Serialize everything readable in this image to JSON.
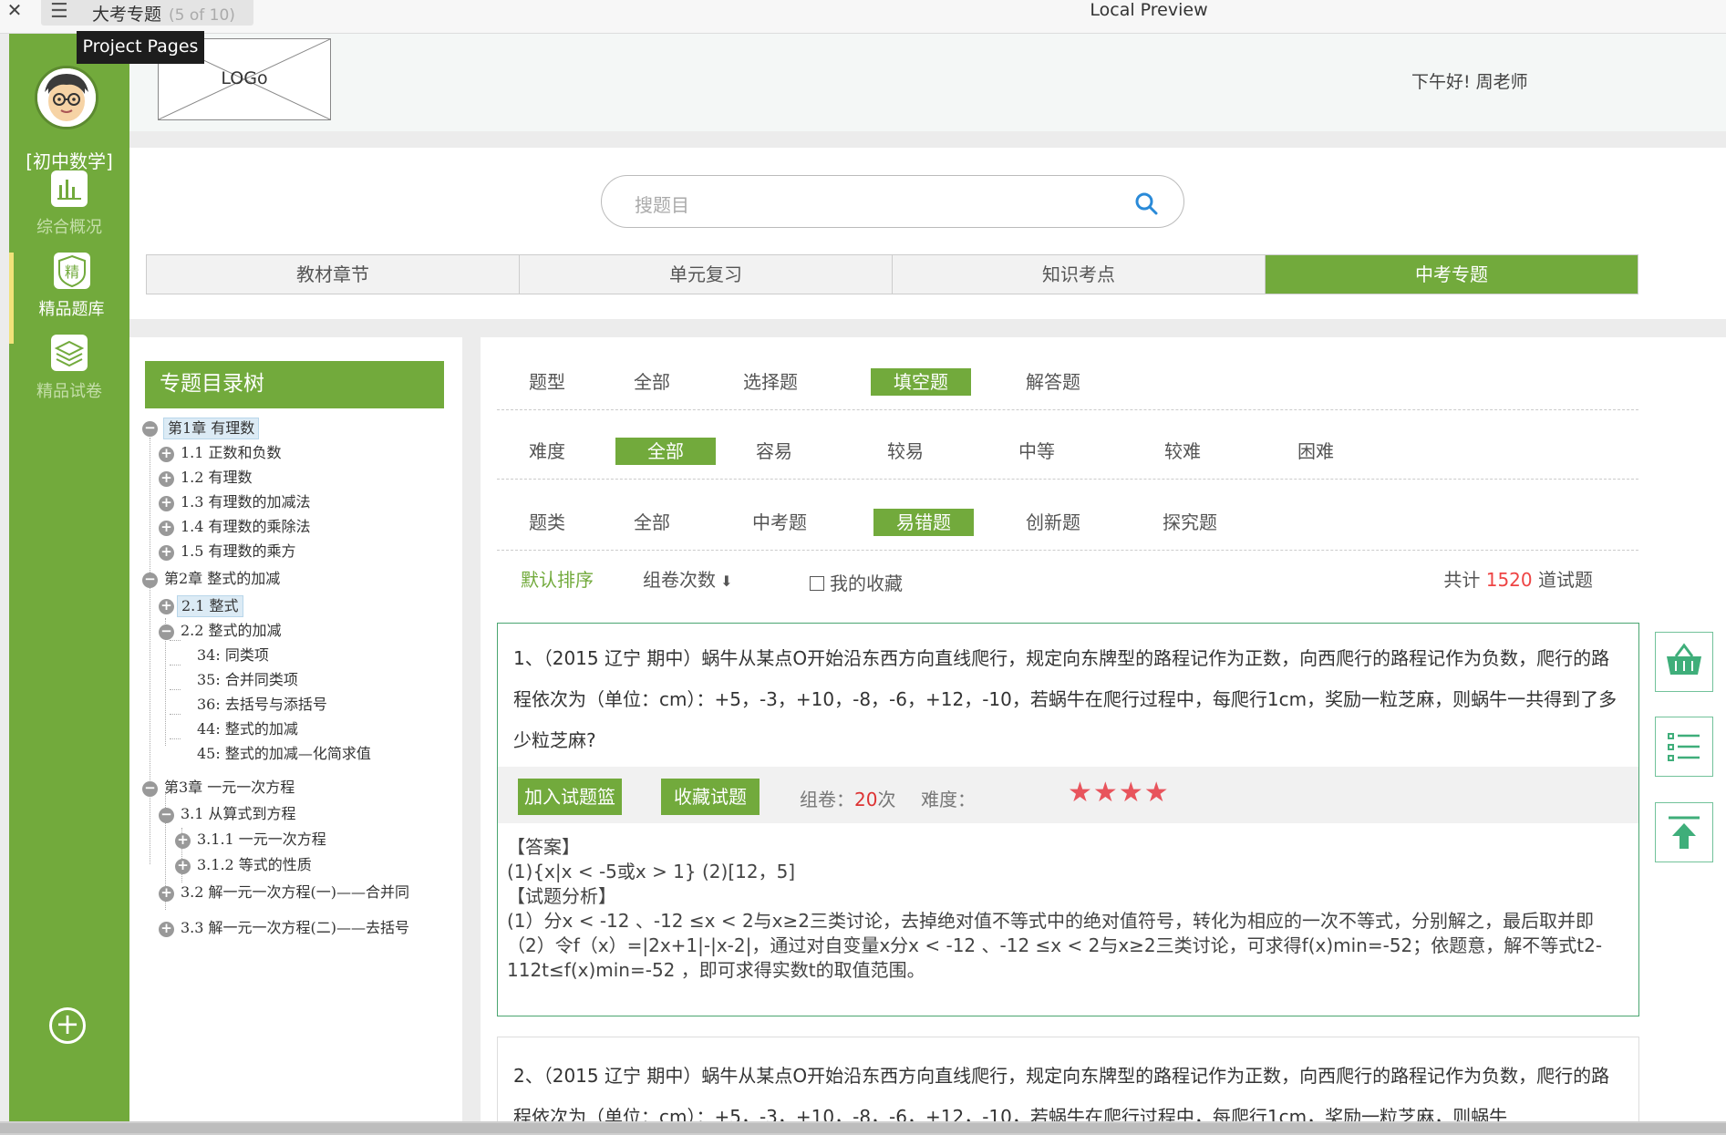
{
  "window": {
    "tab_title": "大考专题",
    "tab_count": "(5 of 10)",
    "center_title": "Local Preview",
    "tooltip": "Project Pages"
  },
  "sidebar": {
    "subject": "[初中数学]",
    "items": [
      {
        "label": "综合概况",
        "icon": "bar-chart-icon"
      },
      {
        "label": "精品题库",
        "icon": "badge-jing-icon"
      },
      {
        "label": "精品试卷",
        "icon": "layers-icon"
      }
    ]
  },
  "header": {
    "logo": "LOGo",
    "greeting": "下午好! 周老师"
  },
  "search": {
    "placeholder": "搜题目"
  },
  "tabs": [
    "教材章节",
    "单元复习",
    "知识考点",
    "中考专题"
  ],
  "tree": {
    "title": "专题目录树",
    "nodes": [
      "第1章 有理数",
      "1.1 正数和负数",
      "1.2 有理数",
      "1.3 有理数的加减法",
      "1.4 有理数的乘除法",
      "1.5 有理数的乘方",
      "第2章 整式的加减",
      "2.1 整式",
      "2.2 整式的加减",
      "34: 同类项",
      "35: 合并同类项",
      "36: 去括号与添括号",
      "44: 整式的加减",
      "45: 整式的加减—化简求值",
      "第3章 一元一次方程",
      "3.1 从算式到方程",
      "3.1.1 一元一次方程",
      "3.1.2 等式的性质",
      "3.2 解一元一次方程(一)——合并同",
      "3.3 解一元一次方程(二)——去括号"
    ]
  },
  "filters": {
    "type": {
      "label": "题型",
      "options": [
        "全部",
        "选择题",
        "填空题",
        "解答题"
      ]
    },
    "difficulty": {
      "label": "难度",
      "options": [
        "全部",
        "容易",
        "较易",
        "中等",
        "较难",
        "困难"
      ]
    },
    "category": {
      "label": "题类",
      "options": [
        "全部",
        "中考题",
        "易错题",
        "创新题",
        "探究题"
      ]
    }
  },
  "sort": {
    "default": "默认排序",
    "by_count": "组卷次数",
    "favorites": "我的收藏",
    "total_prefix": "共计",
    "total_count": "1520",
    "total_suffix": "道试题"
  },
  "question1": {
    "text": "1、（2015 辽宁 期中）蜗牛从某点O开始沿东西方向直线爬行，规定向东牌型的路程记作为正数，向西爬行的路程记作为负数，爬行的路程依次为（单位：cm）：+5，-3，+10，-8，-6，+12，-10，若蜗牛在爬行过程中，每爬行1cm，奖励一粒芝麻，则蜗牛一共得到了多少粒芝麻?",
    "add_btn": "加入试题篮",
    "fav_btn": "收藏试题",
    "usage_prefix": "组卷：",
    "usage_count": "20",
    "usage_suffix": "次",
    "difficulty_label": "难度：",
    "difficulty_stars": 4,
    "answer_title": "【答案】",
    "answer": "(1){x|x < -5或x > 1} (2)[12，5]",
    "analysis_title": "【试题分析】",
    "analysis": "(1）分x < -12 、-12 ≤x < 2与x≥2三类讨论，去掉绝对值不等式中的绝对值符号，转化为相应的一次不等式，分别解之，最后取并即（2）令f（x）=|2x+1|-|x-2|，通过对自变量x分x < -12 、-12 ≤x < 2与x≥2三类讨论，可求得f(x)min=-52；依题意，解不等式t2-112t≤f(x)min=-52 ，即可求得实数t的取值范围。"
  },
  "question2": {
    "text": "2、（2015 辽宁 期中）蜗牛从某点O开始沿东西方向直线爬行，规定向东牌型的路程记作为正数，向西爬行的路程记作为负数，爬行的路程依次为（单位：cm）：+5，-3，+10，-8，-6，+12，-10，若蜗牛在爬行过程中，每爬行1cm，奖励一粒芝麻，则蜗牛"
  },
  "colors": {
    "accent": "#72aa3c",
    "highlight": "#e44",
    "star": "#e8545c"
  }
}
